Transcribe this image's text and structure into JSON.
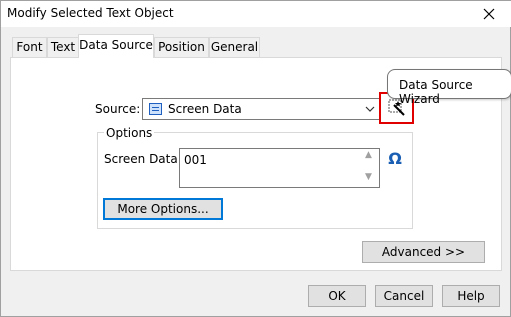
{
  "window": {
    "title": "Modify Selected Text Object",
    "close_glyph": "✕"
  },
  "tabs": [
    {
      "label": "Font"
    },
    {
      "label": "Text"
    },
    {
      "label": "Data Source",
      "active": true
    },
    {
      "label": "Position"
    },
    {
      "label": "General"
    }
  ],
  "source": {
    "label": "Source:",
    "value": "Screen Data",
    "wizard_tooltip": "Data Source Wizard"
  },
  "options": {
    "legend": "Options",
    "screen_data_label": "Screen Data:",
    "screen_data_value": "001",
    "more_options_label": "More Options...",
    "omega_glyph": "Ω"
  },
  "buttons": {
    "advanced": "Advanced >>",
    "ok": "OK",
    "cancel": "Cancel",
    "help": "Help"
  },
  "colors": {
    "highlight_box": "#e00000",
    "focus_border": "#0078d7",
    "omega": "#1a5fb4"
  }
}
